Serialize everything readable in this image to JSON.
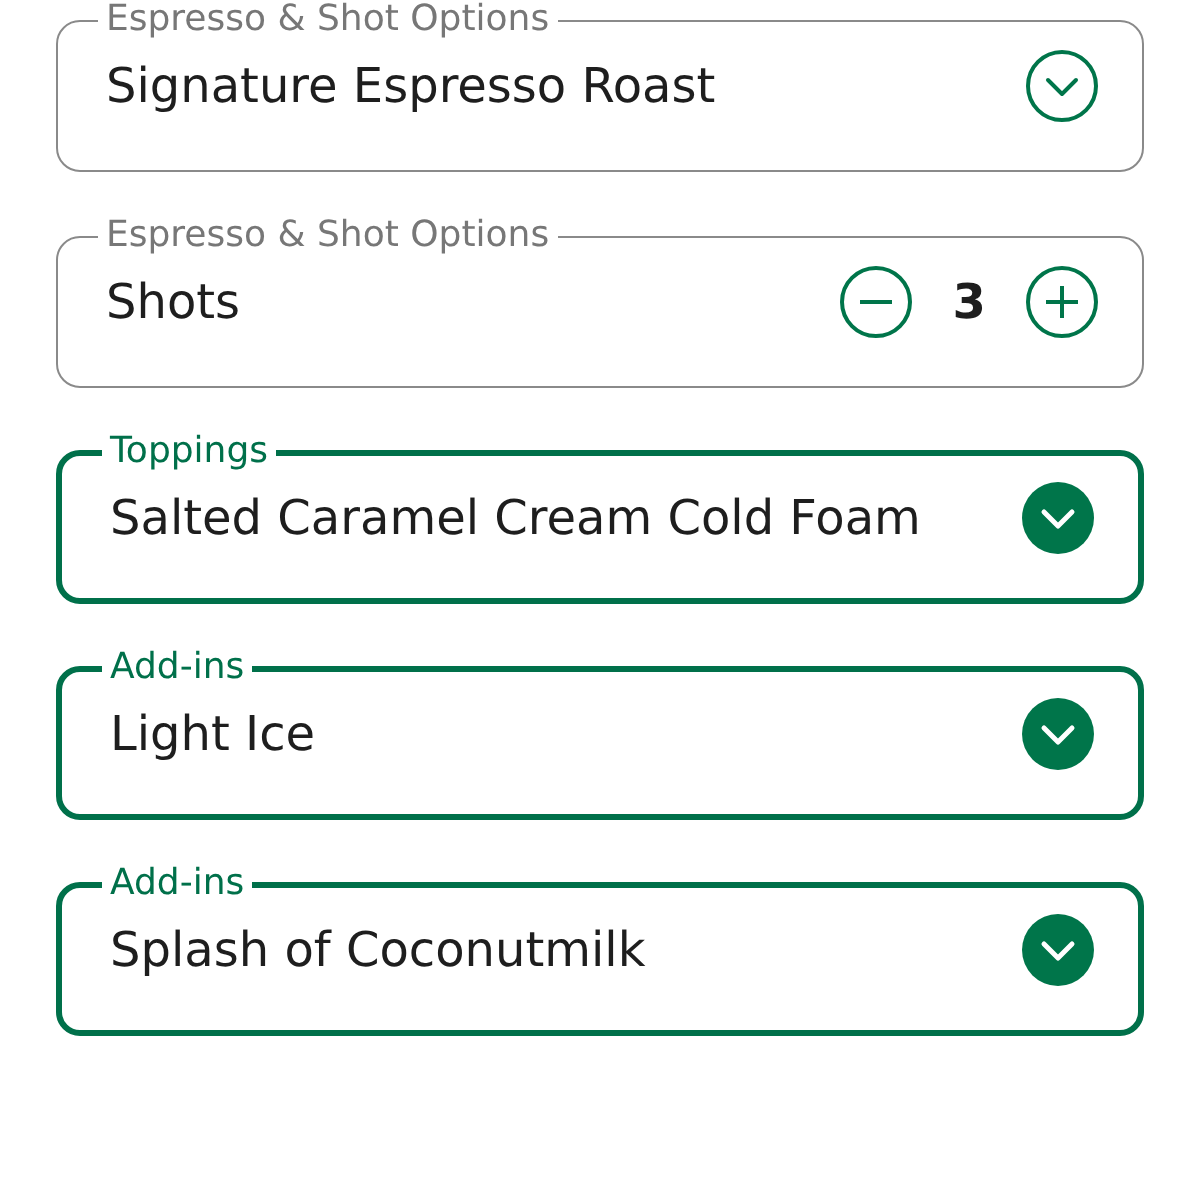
{
  "fields": [
    {
      "kind": "select",
      "label": "Espresso & Shot Options",
      "value": "Signature Espresso Roast",
      "customized": false
    },
    {
      "kind": "stepper",
      "label": "Espresso & Shot Options",
      "value": "Shots",
      "count": "3",
      "customized": false
    },
    {
      "kind": "select",
      "label": "Toppings",
      "value": "Salted Caramel Cream Cold Foam",
      "customized": true
    },
    {
      "kind": "select",
      "label": "Add-ins",
      "value": "Light Ice",
      "customized": true
    },
    {
      "kind": "select",
      "label": "Add-ins",
      "value": "Splash of Coconutmilk",
      "customized": true
    }
  ]
}
